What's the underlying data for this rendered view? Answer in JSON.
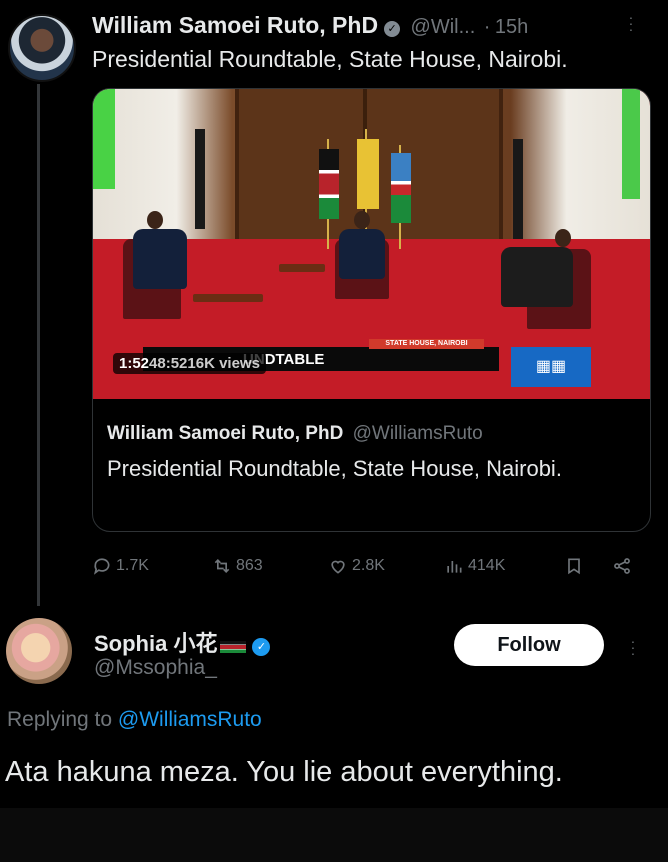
{
  "tweet": {
    "author_name": "William Samoei Ruto, PhD",
    "author_handle": "@Wil...",
    "separator": "·",
    "time": "15h",
    "text": "Presidential Roundtable, State House, Nairobi.",
    "video": {
      "time_badge": "1:52",
      "views_overlay": "48:5216K views",
      "banner_tag": "STATE HOUSE, NAIROBI",
      "banner_text": "UNDTABLE"
    },
    "quoted": {
      "author_name": "William Samoei Ruto, PhD",
      "author_handle": "@WilliamsRuto",
      "text": "Presidential Roundtable, State House, Nairobi."
    },
    "actions": {
      "replies": "1.7K",
      "retweets": "863",
      "likes": "2.8K",
      "views": "414K"
    }
  },
  "reply": {
    "author_name": "Sophia 小花",
    "flag_icon": "kenya-flag-icon",
    "author_handle": "@Mssophia_",
    "follow_label": "Follow",
    "replying_prefix": "Replying to",
    "replying_handle": "@WilliamsRuto",
    "text": "Ata hakuna meza. You lie about everything."
  },
  "colors": {
    "background": "#000000",
    "text": "#e7e9ea",
    "muted": "#71767b",
    "link": "#1d9bf0",
    "verified_gray": "#828b93",
    "verified_blue": "#1d9bf0"
  }
}
